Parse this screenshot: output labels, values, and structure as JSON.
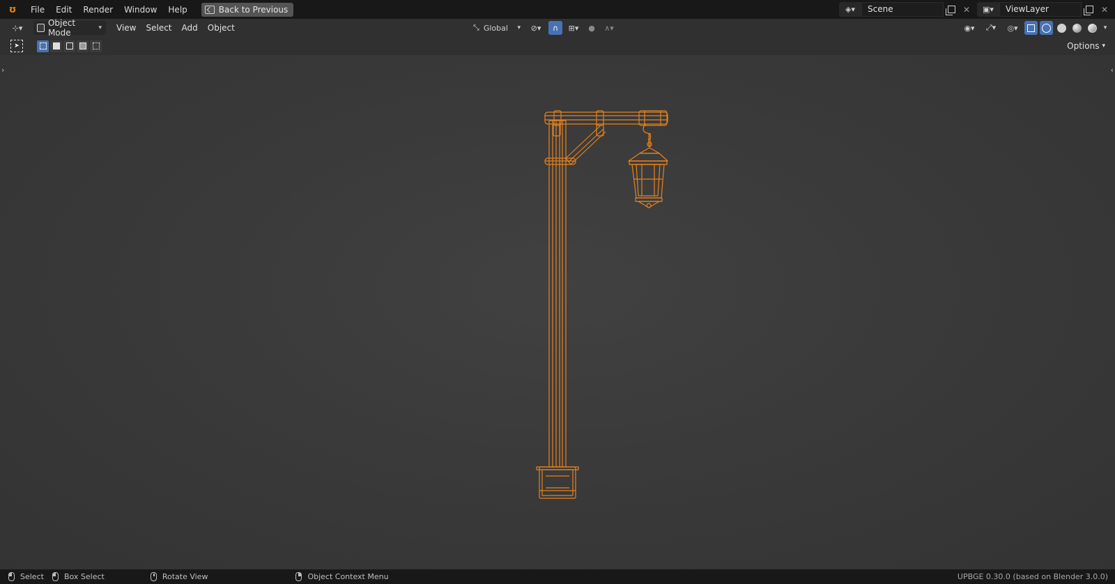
{
  "topbar": {
    "menu": [
      "File",
      "Edit",
      "Render",
      "Window",
      "Help"
    ],
    "back_button": "Back to Previous",
    "scene": "Scene",
    "view_layer": "ViewLayer"
  },
  "header": {
    "mode": "Object Mode",
    "menu": [
      "View",
      "Select",
      "Add",
      "Object"
    ],
    "orientation": "Global"
  },
  "tool_header": {
    "options": "Options"
  },
  "statusbar": {
    "select": "Select",
    "box_select": "Box Select",
    "rotate_view": "Rotate View",
    "context_menu": "Object Context Menu",
    "version": "UPBGE 0.30.0 (based on Blender 3.0.0)"
  },
  "colors": {
    "selection_orange": "#e8821c",
    "accent_blue": "#4772b3"
  }
}
